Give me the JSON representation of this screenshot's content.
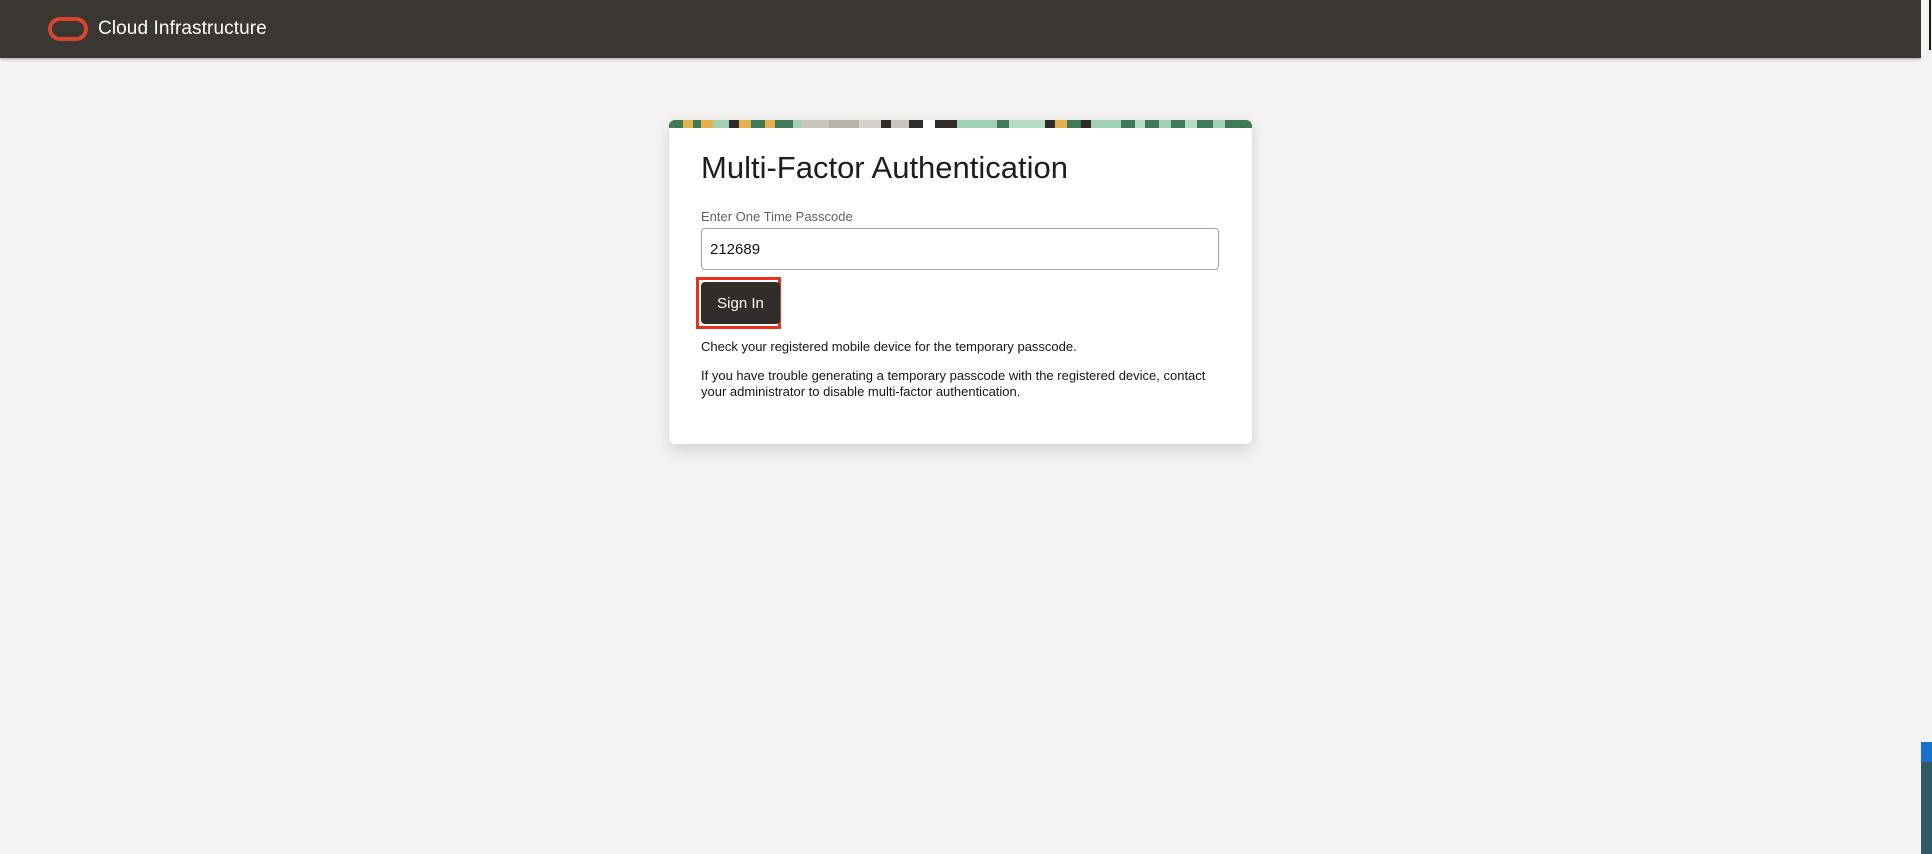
{
  "header": {
    "brand_label": "Cloud Infrastructure",
    "logo_icon": "oracle-logo-icon",
    "bar_color": "#3a3632",
    "logo_color": "#d8442e"
  },
  "card": {
    "title": "Multi-Factor Authentication",
    "field_label": "Enter One Time Passcode",
    "passcode_value": "212689",
    "sign_in_label": "Sign In",
    "help_text": "Check your registered mobile device for the temporary passcode.",
    "trouble_text": "If you have trouble generating a temporary passcode with the registered device, contact your administrator to disable multi-factor authentication.",
    "highlight_color": "#e8331c",
    "button_color": "#312d2a"
  }
}
